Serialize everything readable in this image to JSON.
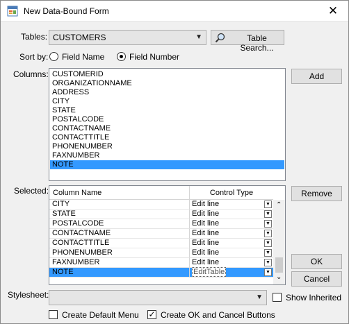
{
  "window": {
    "title": "New Data-Bound Form",
    "close_glyph": "✕"
  },
  "tables": {
    "label": "Tables:",
    "value": "CUSTOMERS",
    "search_button": "Table Search..."
  },
  "sort": {
    "label": "Sort by:",
    "options": [
      "Field Name",
      "Field Number"
    ],
    "selected": "Field Number"
  },
  "columns": {
    "label": "Columns:",
    "items": [
      "CUSTOMERID",
      "ORGANIZATIONNAME",
      "ADDRESS",
      "CITY",
      "STATE",
      "POSTALCODE",
      "CONTACTNAME",
      "CONTACTTITLE",
      "PHONENUMBER",
      "FAXNUMBER",
      "NOTE"
    ],
    "selected": "NOTE",
    "add_button": "Add"
  },
  "selected_grid": {
    "label": "Selected:",
    "headers": [
      "Column Name",
      "Control Type"
    ],
    "rows": [
      {
        "name": "CITY",
        "type": "Edit line"
      },
      {
        "name": "STATE",
        "type": "Edit line"
      },
      {
        "name": "POSTALCODE",
        "type": "Edit line"
      },
      {
        "name": "CONTACTNAME",
        "type": "Edit line"
      },
      {
        "name": "CONTACTTITLE",
        "type": "Edit line"
      },
      {
        "name": "PHONENUMBER",
        "type": "Edit line"
      },
      {
        "name": "FAXNUMBER",
        "type": "Edit line"
      },
      {
        "name": "NOTE",
        "type": "EditTable"
      }
    ],
    "remove_button": "Remove"
  },
  "actions": {
    "ok": "OK",
    "cancel": "Cancel"
  },
  "stylesheet": {
    "label": "Stylesheet:",
    "value": "",
    "show_inherited": "Show Inherited",
    "show_inherited_checked": false
  },
  "options": {
    "default_menu": "Create Default Menu",
    "default_menu_checked": false,
    "ok_cancel": "Create OK and Cancel Buttons",
    "ok_cancel_checked": true
  },
  "colors": {
    "selection": "#3399ff",
    "dialog_bg": "#f0f0f0"
  }
}
